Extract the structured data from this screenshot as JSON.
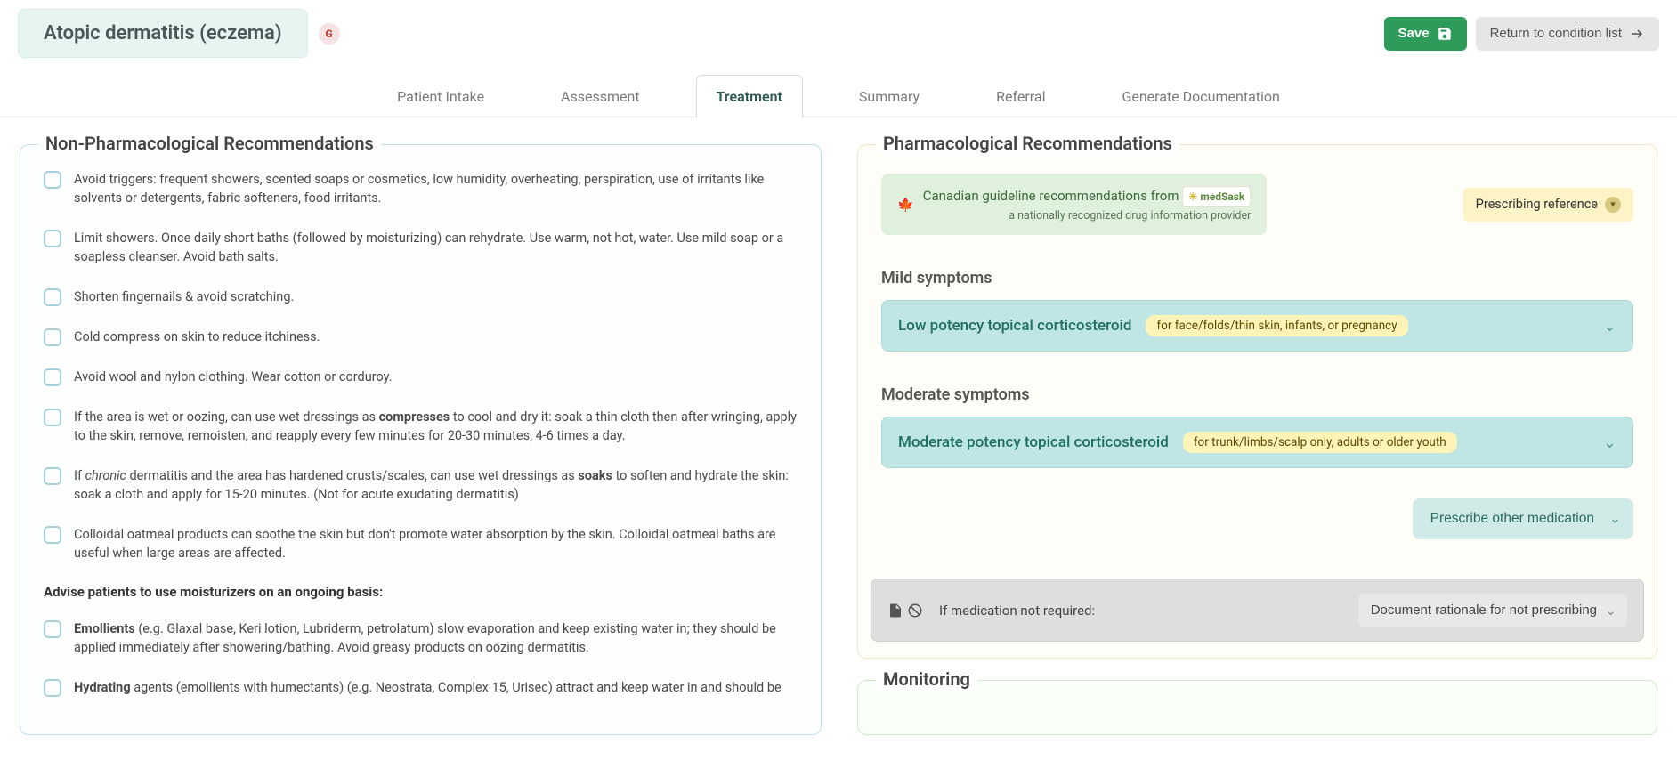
{
  "header": {
    "condition_title": "Atopic dermatitis (eczema)",
    "badge_letter": "G",
    "save_label": "Save",
    "return_label": "Return to condition list"
  },
  "tabs": [
    {
      "label": "Patient Intake",
      "active": false
    },
    {
      "label": "Assessment",
      "active": false
    },
    {
      "label": "Treatment",
      "active": true
    },
    {
      "label": "Summary",
      "active": false
    },
    {
      "label": "Referral",
      "active": false
    },
    {
      "label": "Generate Documentation",
      "active": false
    }
  ],
  "nonpharm": {
    "title": "Non-Pharmacological Recommendations",
    "items": [
      {
        "segments": [
          {
            "t": "Avoid triggers: frequent showers, scented soaps or cosmetics, low humidity, overheating, perspiration, use of irritants like solvents or detergents, fabric softeners, food irritants."
          }
        ]
      },
      {
        "segments": [
          {
            "t": "Limit showers. Once daily short baths (followed by moisturizing) can rehydrate. Use warm, not hot, water. Use mild soap or a soapless cleanser. Avoid bath salts."
          }
        ]
      },
      {
        "segments": [
          {
            "t": "Shorten fingernails & avoid scratching."
          }
        ]
      },
      {
        "segments": [
          {
            "t": "Cold compress on skin to reduce itchiness."
          }
        ]
      },
      {
        "segments": [
          {
            "t": "Avoid wool and nylon clothing. Wear cotton or corduroy."
          }
        ]
      },
      {
        "segments": [
          {
            "t": "If the area is wet or oozing, can use wet dressings as "
          },
          {
            "t": "compresses",
            "b": true
          },
          {
            "t": " to cool and dry it: soak a thin cloth then after wringing, apply to the skin, remove, remoisten, and reapply every few minutes for 20-30 minutes, 4-6 times a day."
          }
        ]
      },
      {
        "segments": [
          {
            "t": "If "
          },
          {
            "t": "chronic",
            "i": true
          },
          {
            "t": " dermatitis and the area has hardened crusts/scales, can use wet dressings as "
          },
          {
            "t": "soaks",
            "b": true
          },
          {
            "t": " to soften and hydrate the skin: soak a cloth and apply for 15-20 minutes. (Not for acute exudating dermatitis)"
          }
        ]
      },
      {
        "segments": [
          {
            "t": "Colloidal oatmeal products can soothe the skin but don't promote water absorption by the skin. Colloidal oatmeal baths are useful when large areas are affected."
          }
        ]
      }
    ],
    "moisturizer_heading": "Advise patients to use moisturizers on an ongoing basis:",
    "moisturizer_items": [
      {
        "segments": [
          {
            "t": "Emollients",
            "b": true
          },
          {
            "t": " (e.g. Glaxal base, Keri lotion, Lubriderm, petrolatum) slow evaporation and keep existing water in; they should be applied immediately after showering/bathing. Avoid greasy products on oozing dermatitis."
          }
        ]
      },
      {
        "segments": [
          {
            "t": "Hydrating",
            "b": true
          },
          {
            "t": " agents (emollients with humectants) (e.g. Neostrata, Complex 15, Urisec) attract and keep water in and should be"
          }
        ]
      }
    ]
  },
  "pharm": {
    "title": "Pharmacological Recommendations",
    "guideline_text": "Canadian guideline recommendations from",
    "guideline_sub": "a nationally recognized drug information provider",
    "medsask_label": "medSask",
    "ref_label": "Prescribing reference",
    "sections": [
      {
        "label": "Mild symptoms",
        "card": {
          "title": "Low potency topical corticosteroid",
          "tag": "for face/folds/thin skin, infants, or pregnancy"
        }
      },
      {
        "label": "Moderate symptoms",
        "card": {
          "title": "Moderate potency topical corticosteroid",
          "tag": "for trunk/limbs/scalp only, adults or older youth"
        }
      }
    ],
    "other_med_label": "Prescribe other medication",
    "rationale": {
      "prompt": "If medication not required:",
      "button": "Document rationale for not prescribing"
    }
  },
  "monitoring": {
    "title": "Monitoring"
  }
}
